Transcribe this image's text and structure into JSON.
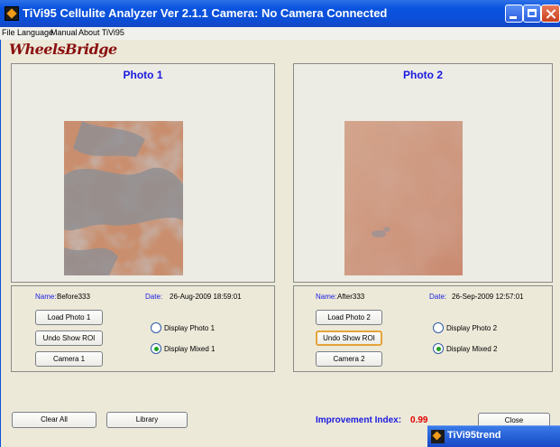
{
  "window": {
    "title": "TiVi95 Cellulite Analyzer Ver 2.1.1  Camera: No Camera Connected"
  },
  "menu": [
    "File",
    "Language",
    "Manual",
    "About TiVi95"
  ],
  "logo_text": "WheelsBridge",
  "photo1": {
    "title": "Photo 1",
    "name_label": "Name:",
    "name_value": "Before333",
    "date_label": "Date:",
    "date_value": "26-Aug-2009 18:59:01",
    "load_button": "Load Photo 1",
    "roi_button": "Undo Show ROI",
    "camera_button": "Camera 1",
    "radio_display": "Display Photo 1",
    "radio_mixed": "Display Mixed 1",
    "selected": "mixed"
  },
  "photo2": {
    "title": "Photo 2",
    "name_label": "Name:",
    "name_value": "After333",
    "date_label": "Date:",
    "date_value": "26-Sep-2009 12:57:01",
    "load_button": "Load Photo 2",
    "roi_button": "Undo Show ROI",
    "camera_button": "Camera 2",
    "radio_display": "Display Photo 2",
    "radio_mixed": "Display Mixed 2",
    "selected": "mixed"
  },
  "bottom": {
    "clear_button": "Clear All",
    "library_button": "Library",
    "improvement_label": "Improvement Index:",
    "improvement_value": "0.99",
    "close_button": "Close"
  },
  "taskbar": {
    "item_label": "TiVi95trend"
  },
  "colors": {
    "title_bar": "#0b4fd8",
    "panel_title": "#1a1ae0",
    "improvement_value": "#e00000",
    "skin": "#c98f72",
    "overlay": "#8c8d92"
  }
}
